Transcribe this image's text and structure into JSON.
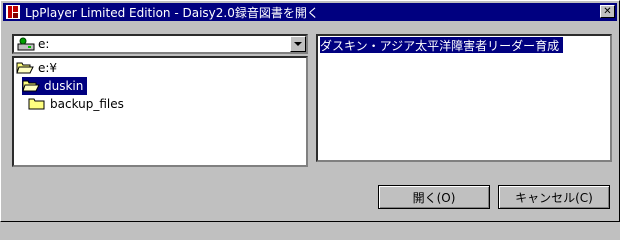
{
  "window": {
    "title": "LpPlayer Limited Edition - Daisy2.0録音図書を開く",
    "close_symbol": "✕"
  },
  "drive_combo": {
    "value": "e:",
    "icon": "drive-icon"
  },
  "tree": {
    "items": [
      {
        "label": "e:¥",
        "icon": "open-folder-icon"
      },
      {
        "label": "duskin",
        "icon": "open-folder-icon"
      },
      {
        "label": "backup_files",
        "icon": "folder-icon"
      }
    ]
  },
  "book_list": {
    "items": [
      {
        "label": "ダスキン・アジア太平洋障害者リーダー育成"
      }
    ]
  },
  "buttons": {
    "open_label": "開く(O)",
    "cancel_label": "キャンセル(C)"
  },
  "colors": {
    "selection": "#000080",
    "titlebar": "#000080",
    "face": "#c0c0c0"
  }
}
